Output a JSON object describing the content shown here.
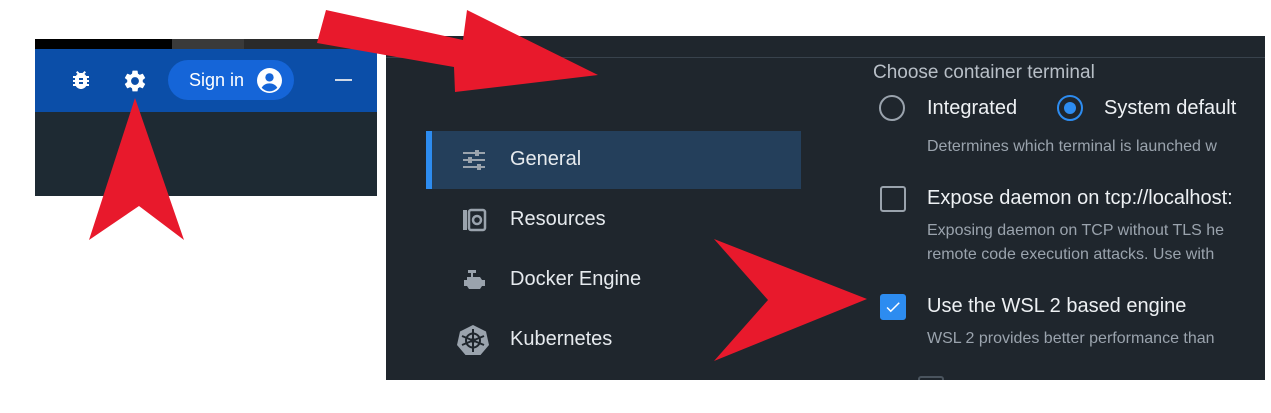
{
  "colors": {
    "topbar": "#0b4ea8",
    "accent": "#2d8cf0",
    "panel_bg": "#1f262d",
    "annotation_arrow": "#e8192c"
  },
  "topbar": {
    "icons": [
      "bug-icon",
      "gear-icon",
      "avatar-icon",
      "minimize-icon"
    ],
    "signin_label": "Sign in"
  },
  "sidebar": {
    "items": [
      {
        "label": "General",
        "icon": "sliders-icon",
        "active": true
      },
      {
        "label": "Resources",
        "icon": "resources-icon",
        "active": false
      },
      {
        "label": "Docker Engine",
        "icon": "engine-icon",
        "active": false
      },
      {
        "label": "Kubernetes",
        "icon": "kubernetes-icon",
        "active": false
      }
    ]
  },
  "settings": {
    "terminal_heading": "Choose container terminal",
    "terminal_options": [
      {
        "label": "Integrated",
        "selected": false
      },
      {
        "label": "System default",
        "selected": true
      }
    ],
    "terminal_desc": "Determines which terminal is launched w",
    "expose_label": "Expose daemon on tcp://localhost:",
    "expose_checked": false,
    "expose_desc_1": "Exposing daemon on TCP without TLS he",
    "expose_desc_2": "remote code execution attacks. Use with",
    "wsl_label": "Use the WSL 2 based engine",
    "wsl_checked": true,
    "wsl_desc": "WSL 2 provides better performance than"
  }
}
